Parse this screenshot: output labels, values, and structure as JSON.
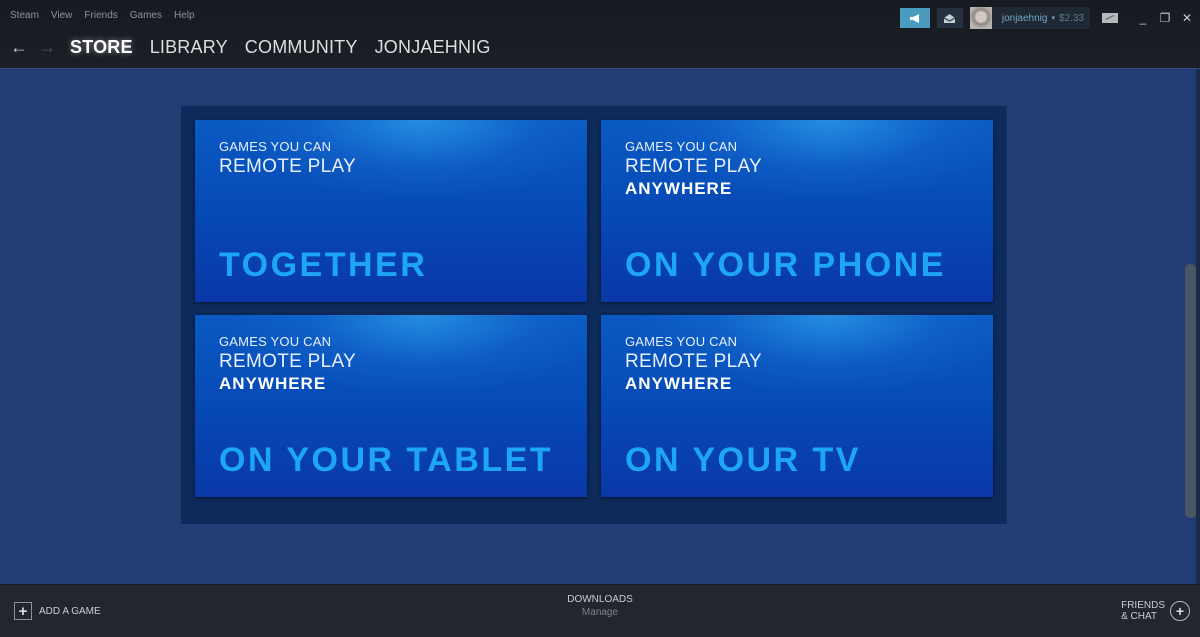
{
  "menubar": {
    "items": [
      "Steam",
      "View",
      "Friends",
      "Games",
      "Help"
    ]
  },
  "nav": {
    "back_icon": "←",
    "forward_icon": "→",
    "tabs": [
      "STORE",
      "LIBRARY",
      "COMMUNITY",
      "JONJAEHNIG"
    ],
    "active_tab": "STORE"
  },
  "account": {
    "username": "jonjaehnig",
    "caret": "▾",
    "wallet": "$2.33"
  },
  "window_controls": {
    "minimize": "_",
    "maximize": "❐",
    "close": "✕"
  },
  "cards": [
    {
      "line1": "GAMES YOU CAN",
      "line2": "REMOTE PLAY",
      "line3": "",
      "headline": "TOGETHER"
    },
    {
      "line1": "GAMES YOU CAN",
      "line2": "REMOTE PLAY",
      "line3": "ANYWHERE",
      "headline": "ON YOUR PHONE"
    },
    {
      "line1": "GAMES YOU CAN",
      "line2": "REMOTE PLAY",
      "line3": "ANYWHERE",
      "headline": "ON YOUR TABLET"
    },
    {
      "line1": "GAMES YOU CAN",
      "line2": "REMOTE PLAY",
      "line3": "ANYWHERE",
      "headline": "ON YOUR TV"
    }
  ],
  "bottombar": {
    "add_game_icon": "+",
    "add_game_label": "ADD A GAME",
    "downloads_title": "DOWNLOADS",
    "downloads_sub": "Manage",
    "friends_line1": "FRIENDS",
    "friends_line2": "& CHAT",
    "friends_icon": "+"
  },
  "colors": {
    "accent_blue": "#1ea6f6",
    "content_bg": "#233d74",
    "announce_btn": "#4a9bbd"
  }
}
